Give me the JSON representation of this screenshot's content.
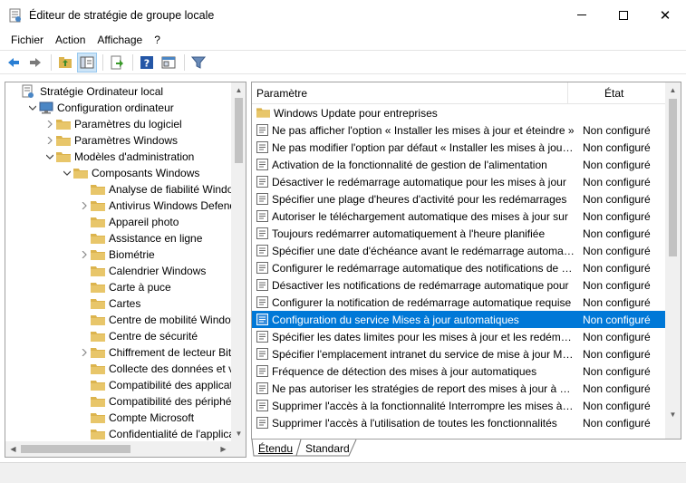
{
  "window": {
    "title": "Éditeur de stratégie de groupe locale",
    "minimize_glyph": "",
    "maximize_glyph": "",
    "close_glyph": "✕"
  },
  "menu": {
    "items": [
      "Fichier",
      "Action",
      "Affichage",
      "?"
    ]
  },
  "toolbar": {
    "buttons": [
      "back-arrow-icon",
      "forward-arrow-icon",
      "up-folder-icon",
      "show-hide-tree-icon",
      "export-list-icon",
      "help-icon",
      "properties-view-icon",
      "filter-icon"
    ]
  },
  "tree": {
    "items": [
      {
        "label": "Stratégie Ordinateur local",
        "expander": ""
      },
      {
        "label": "Configuration ordinateur",
        "expander": "expanded"
      },
      {
        "label": "Paramètres du logiciel",
        "expander": "collapsed"
      },
      {
        "label": "Paramètres Windows",
        "expander": "collapsed"
      },
      {
        "label": "Modèles d'administration",
        "expander": "expanded"
      },
      {
        "label": "Composants Windows",
        "expander": "expanded"
      },
      {
        "label": "Analyse de fiabilité Windows",
        "expander": ""
      },
      {
        "label": "Antivirus Windows Defender",
        "expander": "collapsed"
      },
      {
        "label": "Appareil photo",
        "expander": ""
      },
      {
        "label": "Assistance en ligne",
        "expander": ""
      },
      {
        "label": "Biométrie",
        "expander": "collapsed"
      },
      {
        "label": "Calendrier Windows",
        "expander": ""
      },
      {
        "label": "Carte à puce",
        "expander": ""
      },
      {
        "label": "Cartes",
        "expander": ""
      },
      {
        "label": "Centre de mobilité Windows",
        "expander": ""
      },
      {
        "label": "Centre de sécurité",
        "expander": ""
      },
      {
        "label": "Chiffrement de lecteur BitLocker",
        "expander": "collapsed"
      },
      {
        "label": "Collecte des données et versions d'évaluation",
        "expander": ""
      },
      {
        "label": "Compatibilité des applications",
        "expander": ""
      },
      {
        "label": "Compatibilité des périphériques",
        "expander": ""
      },
      {
        "label": "Compte Microsoft",
        "expander": ""
      },
      {
        "label": "Confidentialité de l'application",
        "expander": ""
      }
    ]
  },
  "list": {
    "columns": {
      "parameter": "Paramètre",
      "state": "État"
    },
    "rows": [
      {
        "text": "Windows Update pour entreprises",
        "state": "",
        "type": "folder"
      },
      {
        "text": "Ne pas afficher l'option « Installer les mises à jour et éteindre »",
        "state": "Non configuré",
        "type": "setting"
      },
      {
        "text": "Ne pas modifier l'option par défaut « Installer les mises à jour »",
        "state": "Non configuré",
        "type": "setting"
      },
      {
        "text": "Activation de la fonctionnalité de gestion de l'alimentation",
        "state": "Non configuré",
        "type": "setting"
      },
      {
        "text": "Désactiver le redémarrage automatique pour les mises à jour",
        "state": "Non configuré",
        "type": "setting"
      },
      {
        "text": "Spécifier une plage d'heures d'activité pour les redémarrages",
        "state": "Non configuré",
        "type": "setting"
      },
      {
        "text": "Autoriser le téléchargement automatique des mises à jour sur",
        "state": "Non configuré",
        "type": "setting"
      },
      {
        "text": "Toujours redémarrer automatiquement à l'heure planifiée",
        "state": "Non configuré",
        "type": "setting"
      },
      {
        "text": "Spécifier une date d'échéance avant le redémarrage automatique",
        "state": "Non configuré",
        "type": "setting"
      },
      {
        "text": "Configurer le redémarrage automatique des notifications de rappel",
        "state": "Non configuré",
        "type": "setting"
      },
      {
        "text": "Désactiver les notifications de redémarrage automatique pour",
        "state": "Non configuré",
        "type": "setting"
      },
      {
        "text": "Configurer la notification de redémarrage automatique requise",
        "state": "Non configuré",
        "type": "setting"
      },
      {
        "text": "Configuration du service Mises à jour automatiques",
        "state": "Non configuré",
        "type": "setting",
        "selected": true
      },
      {
        "text": "Spécifier les dates limites pour les mises à jour et les redémarrages",
        "state": "Non configuré",
        "type": "setting"
      },
      {
        "text": "Spécifier l'emplacement intranet du service de mise à jour Microsoft",
        "state": "Non configuré",
        "type": "setting"
      },
      {
        "text": "Fréquence de détection des mises à jour automatiques",
        "state": "Non configuré",
        "type": "setting"
      },
      {
        "text": "Ne pas autoriser les stratégies de report des mises à jour à effectuer",
        "state": "Non configuré",
        "type": "setting"
      },
      {
        "text": "Supprimer l'accès à la fonctionnalité Interrompre les mises à jour",
        "state": "Non configuré",
        "type": "setting"
      },
      {
        "text": "Supprimer l'accès à l'utilisation de toutes les fonctionnalités",
        "state": "Non configuré",
        "type": "setting"
      }
    ]
  },
  "tabs": {
    "extended": "Étendu",
    "standard": "Standard"
  },
  "colors": {
    "selection": "#0078d7",
    "folder": "#dcb44e",
    "toolbar_active": "#cce4f7"
  }
}
